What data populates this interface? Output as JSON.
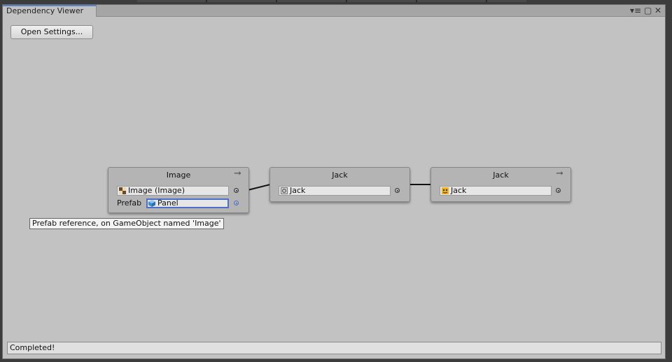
{
  "window": {
    "tab_title": "Dependency Viewer",
    "controls": [
      "menu-icon",
      "maximize-icon",
      "close-icon"
    ]
  },
  "toolbar": {
    "open_settings_label": "Open Settings..."
  },
  "graph": {
    "nodes": [
      {
        "title": "Image",
        "has_arrow": true,
        "fields": [
          {
            "label": "",
            "value": "Image (Image)",
            "icon": "checker-icon",
            "selected": false
          },
          {
            "label": "Prefab",
            "value": "Panel",
            "icon": "prefab-cube-icon",
            "selected": true
          }
        ]
      },
      {
        "title": "Jack",
        "has_arrow": false,
        "fields": [
          {
            "label": "",
            "value": "Jack",
            "icon": "gear-icon",
            "selected": false
          }
        ]
      },
      {
        "title": "Jack",
        "has_arrow": true,
        "fields": [
          {
            "label": "",
            "value": "Jack",
            "icon": "sprite-icon",
            "selected": false
          }
        ]
      }
    ]
  },
  "tooltip": {
    "text": "Prefab reference, on GameObject named 'Image'"
  },
  "status": {
    "text": "Completed!"
  },
  "colors": {
    "canvas_bg": "#c2c2c2",
    "node_bg": "#b4b4b4",
    "selection": "#4e6ec7",
    "tab_accent": "#5a84c6"
  }
}
